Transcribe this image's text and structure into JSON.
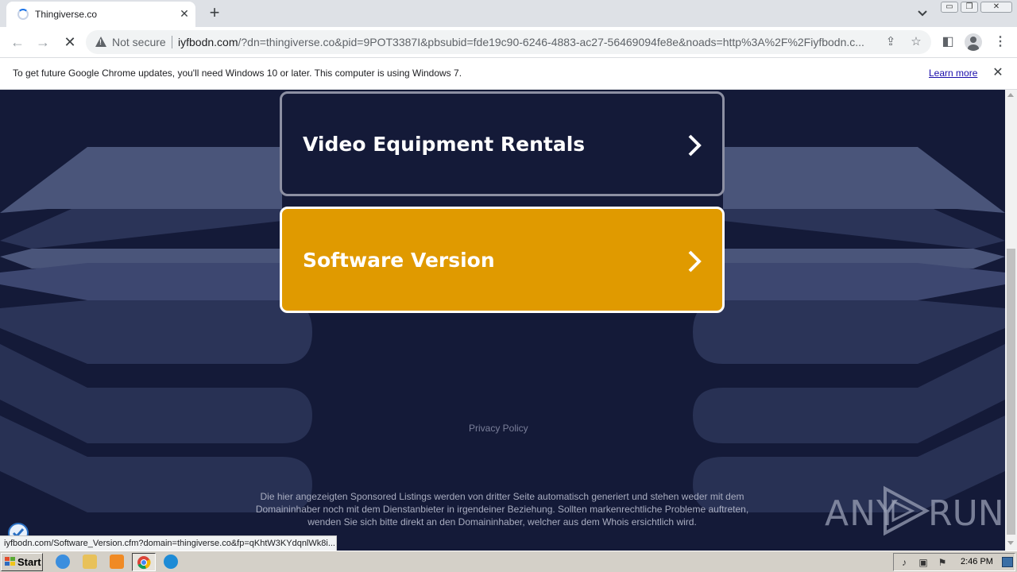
{
  "browser": {
    "tab": {
      "title": "Thingiverse.co",
      "close_glyph": "✕"
    },
    "new_tab_glyph": "+",
    "window_controls": {
      "minimize": "▭",
      "restore": "❐",
      "close": "✕"
    },
    "security_label": "Not secure",
    "url_host": "iyfbodn.com",
    "url_rest": "/?dn=thingiverse.co&pid=9POT3387I&pbsubid=fde19c90-6246-4883-ac27-56469094fe8e&noads=http%3A%2F%2Fiyfbodn.c...",
    "nav": {
      "back": "←",
      "forward": "→",
      "stop": "✕"
    },
    "toolbar_icons": {
      "share": "⇪",
      "bookmark": "☆",
      "side_panel": "◧",
      "menu": "⋮"
    }
  },
  "infobar": {
    "message": "To get future Google Chrome updates, you'll need Windows 10 or later. This computer is using Windows 7.",
    "link": "Learn more",
    "close_glyph": "✕"
  },
  "page": {
    "listings": [
      {
        "label": "Video Equipment Rentals"
      },
      {
        "label": "Software Version"
      }
    ],
    "privacy_link": "Privacy Policy",
    "disclaimer": "Die hier angezeigten Sponsored Listings werden von dritter Seite automatisch generiert und stehen weder mit dem Domaininhaber noch mit dem Dienstanbieter in irgendeiner Beziehung. Sollten markenrechtliche Probleme auftreten, wenden Sie sich bitte direkt an den Domaininhaber, welcher aus dem Whois ersichtlich wird.",
    "watermark": {
      "left": "ANY",
      "right": "RUN"
    },
    "colors": {
      "background": "#141a38",
      "accent": "#e09a00",
      "shape": "#4a557a"
    }
  },
  "status_bar": {
    "url": "iyfbodn.com/Software_Version.cfm?domain=thingiverse.co&fp=qKhtW3KYdqnlWk8i..."
  },
  "taskbar": {
    "start_label": "Start",
    "clock": "2:46 PM",
    "apps": [
      "ie-icon",
      "explorer-icon",
      "media-player-icon",
      "chrome-icon",
      "edge-icon"
    ]
  }
}
